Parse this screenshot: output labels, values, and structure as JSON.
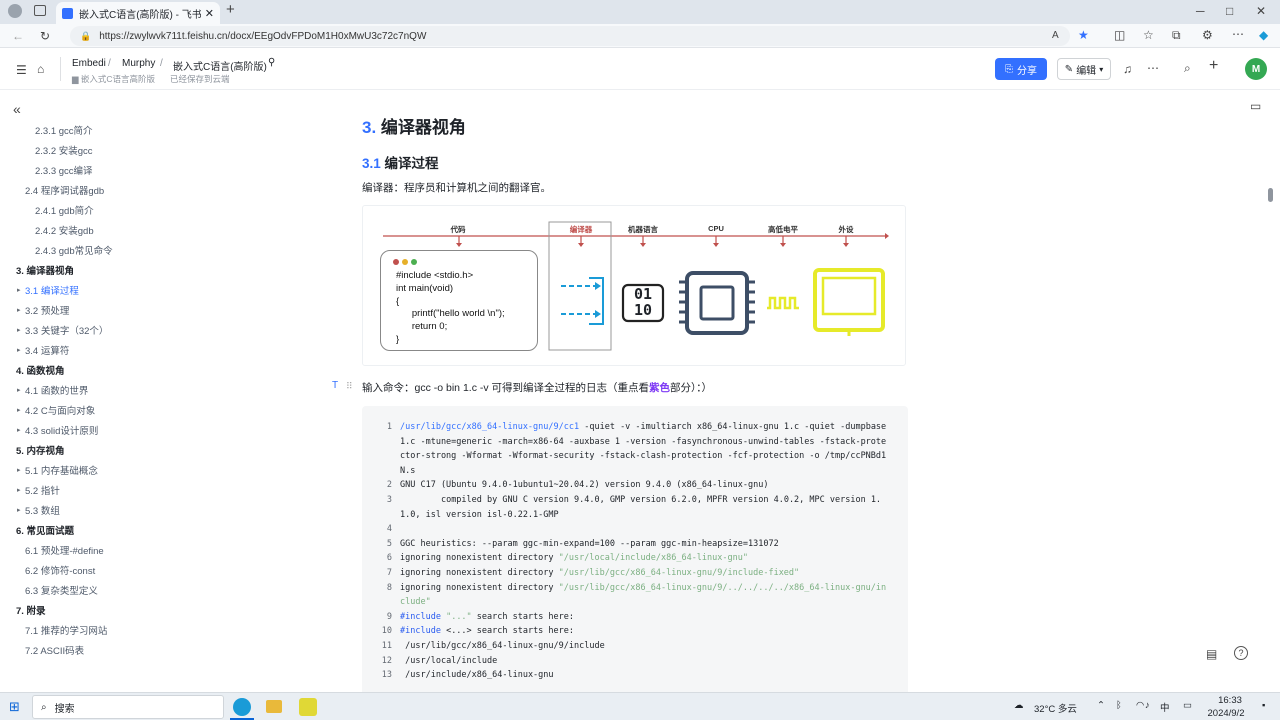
{
  "browser": {
    "tab_title": "嵌入式C语言(高阶版) - 飞书云文档",
    "url": "https://zwylwvk711t.feishu.cn/docx/EEgOdvFPDoM1H0xMwU3c72c7nQW"
  },
  "doc_header": {
    "crumbs": [
      "Embedi",
      "Murphy",
      "嵌入式C语言(高阶版)"
    ],
    "sub_left": "嵌入式C语言高阶版",
    "sub_right": "已经保存到云端",
    "share_label": "分享",
    "edit_label": "编辑",
    "avatar_letter": "M"
  },
  "toc": [
    {
      "label": "2.3.1 gcc简介",
      "level": 3
    },
    {
      "label": "2.3.2 安装gcc",
      "level": 3
    },
    {
      "label": "2.3.3 gcc编译",
      "level": 3
    },
    {
      "label": "2.4 程序调试器gdb",
      "level": 2
    },
    {
      "label": "2.4.1 gdb简介",
      "level": 3
    },
    {
      "label": "2.4.2 安装gdb",
      "level": 3
    },
    {
      "label": "2.4.3 gdb常见命令",
      "level": 3
    },
    {
      "label": "3. 编译器视角",
      "level": 1
    },
    {
      "label": "3.1 编译过程",
      "level": 2,
      "arrow": true,
      "active": true
    },
    {
      "label": "3.2 预处理",
      "level": 2,
      "arrow": true
    },
    {
      "label": "3.3 关键字（32个）",
      "level": 2,
      "arrow": true
    },
    {
      "label": "3.4 运算符",
      "level": 2,
      "arrow": true
    },
    {
      "label": "4. 函数视角",
      "level": 1
    },
    {
      "label": "4.1 函数的世界",
      "level": 2,
      "arrow": true
    },
    {
      "label": "4.2 C与面向对象",
      "level": 2,
      "arrow": true
    },
    {
      "label": "4.3 solid设计原则",
      "level": 2,
      "arrow": true
    },
    {
      "label": "5. 内存视角",
      "level": 1
    },
    {
      "label": "5.1 内存基础概念",
      "level": 2,
      "arrow": true
    },
    {
      "label": "5.2 指针",
      "level": 2,
      "arrow": true
    },
    {
      "label": "5.3 数组",
      "level": 2,
      "arrow": true
    },
    {
      "label": "6. 常见面试题",
      "level": 1
    },
    {
      "label": "6.1 预处理-#define",
      "level": 2
    },
    {
      "label": "6.2 修饰符-const",
      "level": 2
    },
    {
      "label": "6.3 复杂类型定义",
      "level": 2
    },
    {
      "label": "7. 附录",
      "level": 1
    },
    {
      "label": "7.1 推荐的学习网站",
      "level": 2
    },
    {
      "label": "7.2 ASCII码表",
      "level": 2
    }
  ],
  "content": {
    "h2_num": "3.",
    "h2_text": "编译器视角",
    "h3_num": "3.1",
    "h3_text": "编译过程",
    "intro": "编译器：程序员和计算机之间的翻译官。",
    "cmd_before": "输入命令：gcc -o bin 1.c -v 可得到编译全过程的日志（重点看",
    "cmd_highlight": "紫色",
    "cmd_after": "部分）：）"
  },
  "diagram": {
    "labels": [
      "代码",
      "编译器",
      "机器语言",
      "CPU",
      "高低电平",
      "外设"
    ],
    "code_lines": [
      "#include <stdio.h>",
      "int main(void)",
      "{",
      "      printf(\"hello world \\n\");",
      "      return 0;",
      "}"
    ],
    "binary_top": "01",
    "binary_bottom": "10",
    "colors": {
      "arrow": "#c0504d",
      "compiler": "#1a9bd7",
      "screen": "#e6ea2a",
      "chip": "#3d4e66"
    }
  },
  "code": [
    {
      "n": "1",
      "text": "/usr/lib/gcc/x86_64-linux-gnu/9/cc1 -quiet -v -imultiarch x86_64-linux-gnu 1.c -quiet -dumpbase 1.c -mtune=generic -march=x86-64 -auxbase 1 -version -fasynchronous-unwind-tables -fstack-protector-strong -Wformat -Wformat-security -fstack-clash-protection -fcf-protection -o /tmp/ccPNBd1N.s"
    },
    {
      "n": "2",
      "text": "GNU C17 (Ubuntu 9.4.0-1ubuntu1~20.04.2) version 9.4.0 (x86_64-linux-gnu)"
    },
    {
      "n": "3",
      "text": "        compiled by GNU C version 9.4.0, GMP version 6.2.0, MPFR version 4.0.2, MPC version 1.1.0, isl version isl-0.22.1-GMP"
    },
    {
      "n": "4",
      "text": ""
    },
    {
      "n": "5",
      "text": "GGC heuristics: --param ggc-min-expand=100 --param ggc-min-heapsize=131072"
    },
    {
      "n": "6",
      "text": "ignoring nonexistent directory \"/usr/local/include/x86_64-linux-gnu\""
    },
    {
      "n": "7",
      "text": "ignoring nonexistent directory \"/usr/lib/gcc/x86_64-linux-gnu/9/include-fixed\""
    },
    {
      "n": "8",
      "text": "ignoring nonexistent directory \"/usr/lib/gcc/x86_64-linux-gnu/9/../../../../x86_64-linux-gnu/include\""
    },
    {
      "n": "9",
      "text": "#include \"...\" search starts here:"
    },
    {
      "n": "10",
      "text": "#include <...> search starts here:"
    },
    {
      "n": "11",
      "text": " /usr/lib/gcc/x86_64-linux-gnu/9/include"
    },
    {
      "n": "12",
      "text": " /usr/local/include"
    },
    {
      "n": "13",
      "text": " /usr/include/x86_64-linux-gnu"
    }
  ],
  "taskbar": {
    "search": "搜索",
    "weather": "32°C 多云",
    "ime": "中",
    "time": "16:33",
    "date": "2024/9/2"
  }
}
